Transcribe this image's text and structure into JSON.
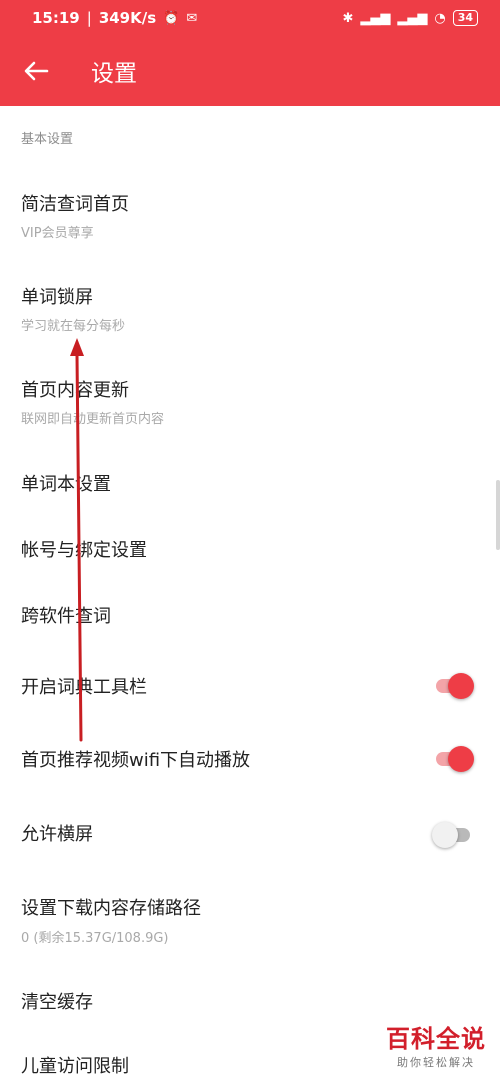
{
  "status_bar": {
    "time": "15:19",
    "speed": "349K/s",
    "battery": "34"
  },
  "app_bar": {
    "title": "设置"
  },
  "section": {
    "title": "基本设置"
  },
  "rows": [
    {
      "title": "简洁查词首页",
      "subtitle": "VIP会员尊享"
    },
    {
      "title": "单词锁屏",
      "subtitle": "学习就在每分每秒"
    },
    {
      "title": "首页内容更新",
      "subtitle": "联网即自动更新首页内容"
    },
    {
      "title": "单词本设置"
    },
    {
      "title": "帐号与绑定设置"
    },
    {
      "title": "跨软件查词"
    },
    {
      "title": "开启词典工具栏",
      "toggle": true
    },
    {
      "title": "首页推荐视频wifi下自动播放",
      "toggle": true
    },
    {
      "title": "允许横屏",
      "toggle": false
    },
    {
      "title": "设置下载内容存储路径",
      "subtitle": "0 (剩余15.37G/108.9G)"
    },
    {
      "title": "清空缓存"
    },
    {
      "title": "儿童访问限制"
    }
  ],
  "watermark": {
    "title": "百科全说",
    "subtitle": "助你轻松解决"
  },
  "colors": {
    "accent": "#ee3d46",
    "annotation_arrow": "#c81e22"
  }
}
